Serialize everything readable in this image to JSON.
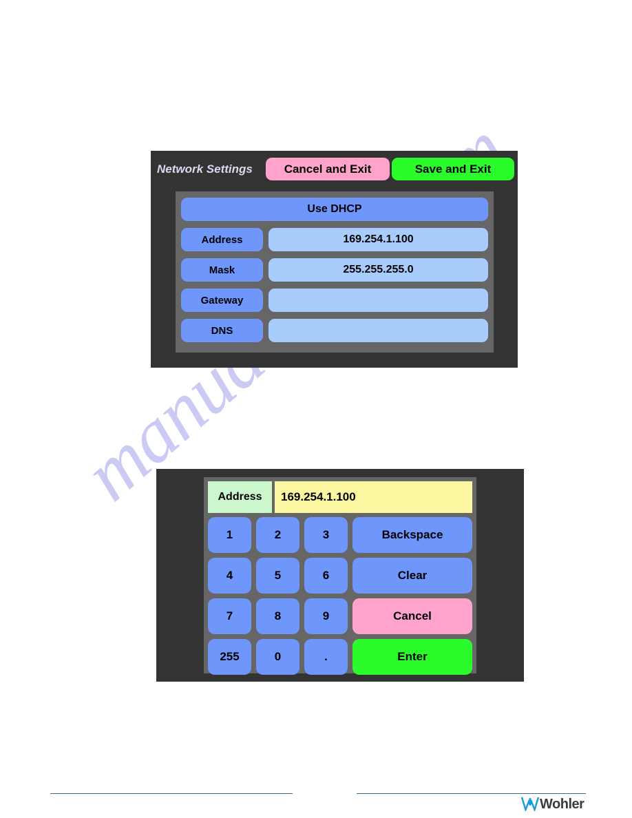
{
  "watermark": {
    "text": "manualshive.com"
  },
  "network_panel": {
    "title": "Network Settings",
    "cancel_label": "Cancel and Exit",
    "save_label": "Save and Exit",
    "dhcp_label": "Use DHCP",
    "rows": [
      {
        "label": "Address",
        "value": "169.254.1.100"
      },
      {
        "label": "Mask",
        "value": "255.255.255.0"
      },
      {
        "label": "Gateway",
        "value": ""
      },
      {
        "label": "DNS",
        "value": ""
      }
    ],
    "colors": {
      "panel_bg": "#333333",
      "inner_bg": "#666666",
      "button_blue": "#6f96fa",
      "field_blue": "#a8cdfd",
      "pink": "#ffa3ca",
      "green": "#2bfb2b",
      "title_text": "#d9d9ef"
    }
  },
  "keypad_panel": {
    "field_label": "Address",
    "field_value": "169.254.1.100",
    "keys": [
      {
        "label": "1",
        "style": "blue"
      },
      {
        "label": "2",
        "style": "blue"
      },
      {
        "label": "3",
        "style": "blue"
      },
      {
        "label": "Backspace",
        "style": "blue"
      },
      {
        "label": "4",
        "style": "blue"
      },
      {
        "label": "5",
        "style": "blue"
      },
      {
        "label": "6",
        "style": "blue"
      },
      {
        "label": "Clear",
        "style": "blue"
      },
      {
        "label": "7",
        "style": "blue"
      },
      {
        "label": "8",
        "style": "blue"
      },
      {
        "label": "9",
        "style": "blue"
      },
      {
        "label": "Cancel",
        "style": "pink"
      },
      {
        "label": "255",
        "style": "blue"
      },
      {
        "label": "0",
        "style": "blue"
      },
      {
        "label": ".",
        "style": "blue"
      },
      {
        "label": "Enter",
        "style": "green"
      }
    ],
    "colors": {
      "label_green": "#ccf6cc",
      "value_yellow": "#fbf6a0",
      "key_blue": "#6f96fa",
      "key_pink": "#ffa3ca",
      "key_green": "#2bfb2b"
    }
  },
  "footer": {
    "brand": "Wohler",
    "brand_color": "#3b3b3b",
    "mark_color": "#1b9bd8",
    "rule_color": "#3d6585"
  }
}
